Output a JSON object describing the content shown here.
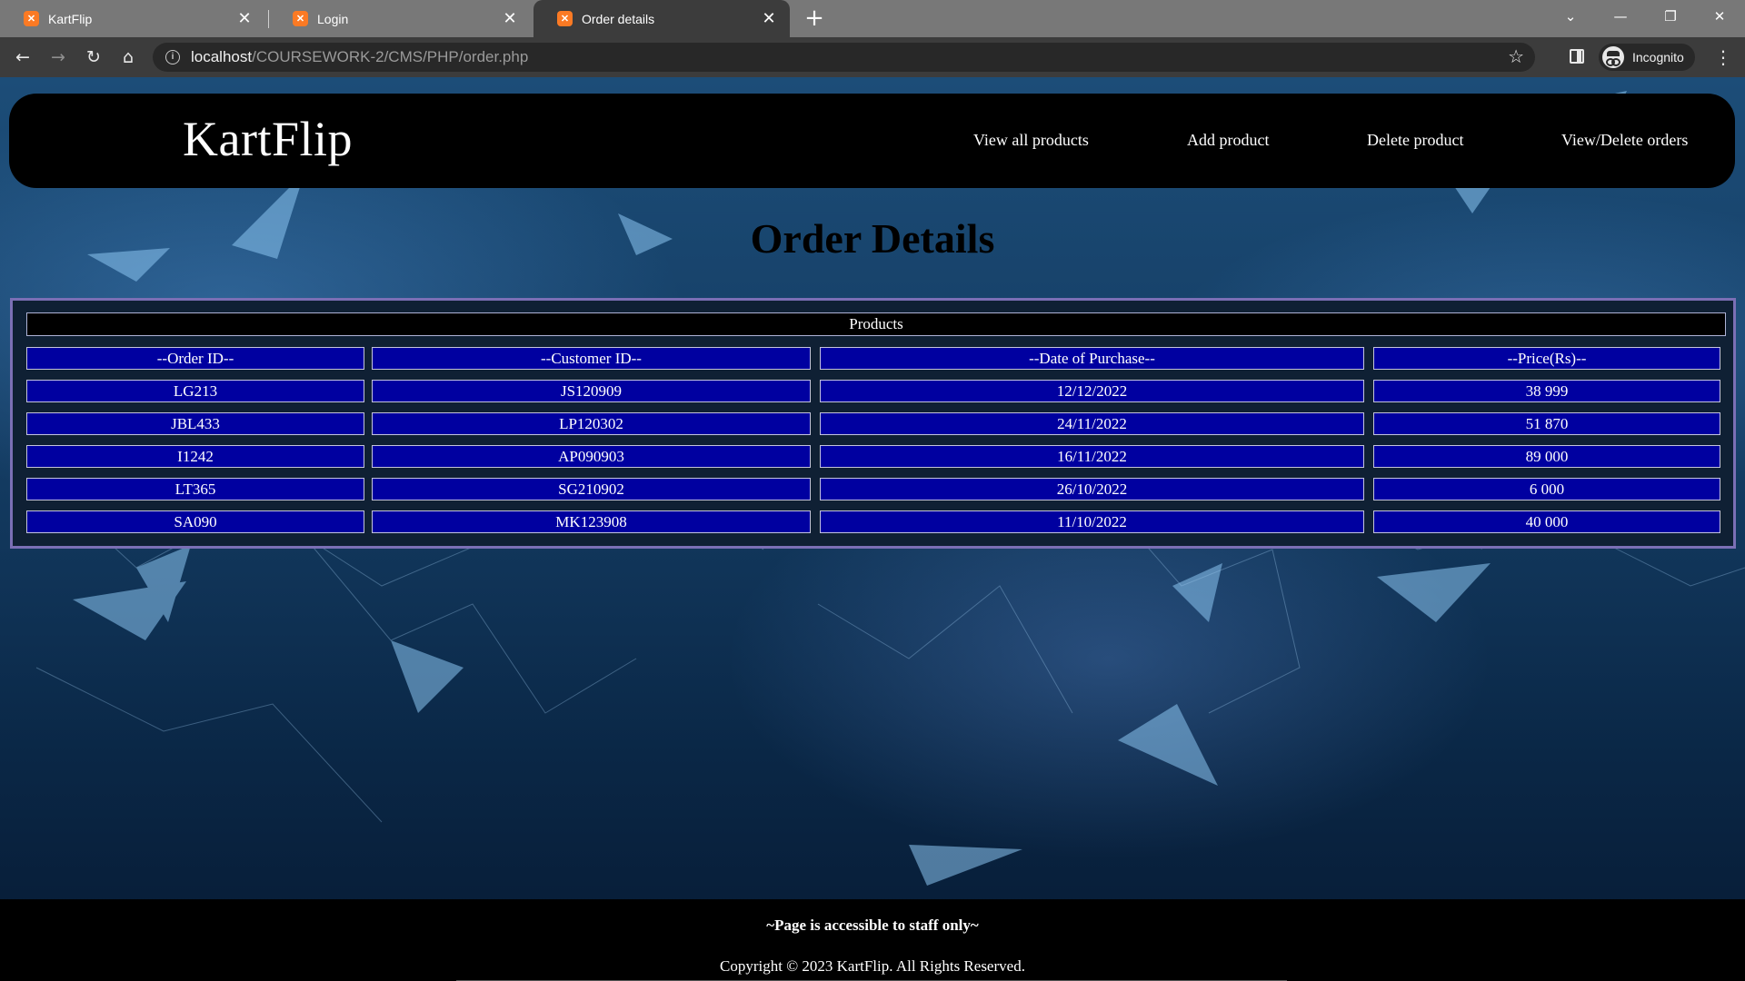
{
  "browser": {
    "tabs": [
      {
        "title": "KartFlip",
        "favicon": "xampp-icon",
        "active": false
      },
      {
        "title": "Login",
        "favicon": "xampp-icon",
        "active": false
      },
      {
        "title": "Order details",
        "favicon": "xampp-icon",
        "active": true
      }
    ],
    "url_host": "localhost",
    "url_path": "/COURSEWORK-2/CMS/PHP/order.php",
    "profile_label": "Incognito"
  },
  "site": {
    "logo": "KartFlip",
    "nav": [
      {
        "label": "View all products"
      },
      {
        "label": "Add product"
      },
      {
        "label": "Delete product"
      },
      {
        "label": "View/Delete orders"
      }
    ]
  },
  "main": {
    "title": "Order Details",
    "table": {
      "caption": "Products",
      "headers": [
        "--Order ID--",
        "--Customer ID--",
        "--Date of Purchase--",
        "--Price(Rs)--"
      ],
      "rows": [
        [
          "LG213",
          "JS120909",
          "12/12/2022",
          "38 999"
        ],
        [
          "JBL433",
          "LP120302",
          "24/11/2022",
          "51 870"
        ],
        [
          "I1242",
          "AP090903",
          "16/11/2022",
          "89 000"
        ],
        [
          "LT365",
          "SG210902",
          "26/10/2022",
          "6 000"
        ],
        [
          "SA090",
          "MK123908",
          "11/10/2022",
          "40 000"
        ]
      ]
    }
  },
  "footer": {
    "note": "~Page is accessible to staff only~",
    "copyright": "Copyright © 2023 KartFlip. All Rights Reserved."
  },
  "colors": {
    "header_bg": "#000000",
    "cell_bg": "#0000a0",
    "table_border": "#7b6fb5",
    "favicon": "#fb7a24"
  }
}
